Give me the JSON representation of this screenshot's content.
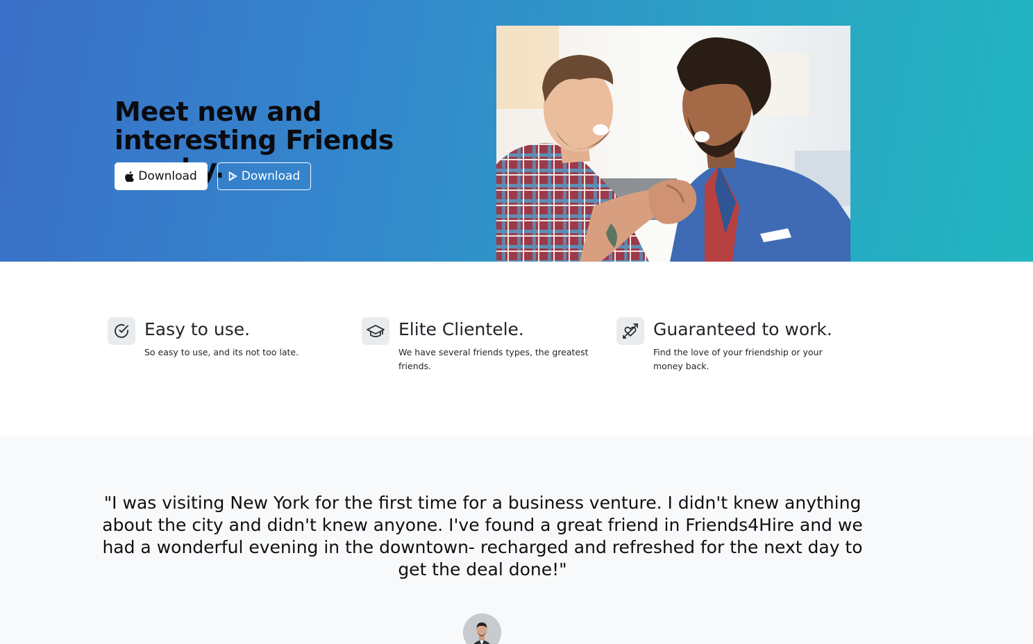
{
  "hero": {
    "title": "Meet new and interesting Friends nearby.",
    "apple_button": {
      "label": "Download",
      "icon": "apple-icon"
    },
    "play_button": {
      "label": "Download",
      "icon": "play-store-icon"
    },
    "image": {
      "icon": "photo-two-friends-handshake"
    }
  },
  "features": [
    {
      "icon": "check-circle-icon",
      "title": "Easy to use.",
      "text": "So easy to use, and its not too late."
    },
    {
      "icon": "graduation-cap-icon",
      "title": "Elite Clientele.",
      "text": "We have several friends types, the greatest friends."
    },
    {
      "icon": "heart-arrow-icon",
      "title": "Guaranteed to work.",
      "text": "Find the love of your friendship or your money back."
    }
  ],
  "testimonial": {
    "quote": "\"I was visiting New York for the first time for a business venture. I didn't knew anything about the city and didn't knew anyone. I've found a great friend in Friends4Hire and we had a wonderful evening in the downtown- recharged and refreshed for the next day to get the deal done!\"",
    "avatar": {
      "icon": "person-avatar"
    }
  },
  "colors": {
    "hero_gradient_start": "#3a6fc7",
    "hero_gradient_end": "#21b6bf",
    "testimonial_bg": "#f8f9fa",
    "icon_bg": "#e9ecef"
  }
}
